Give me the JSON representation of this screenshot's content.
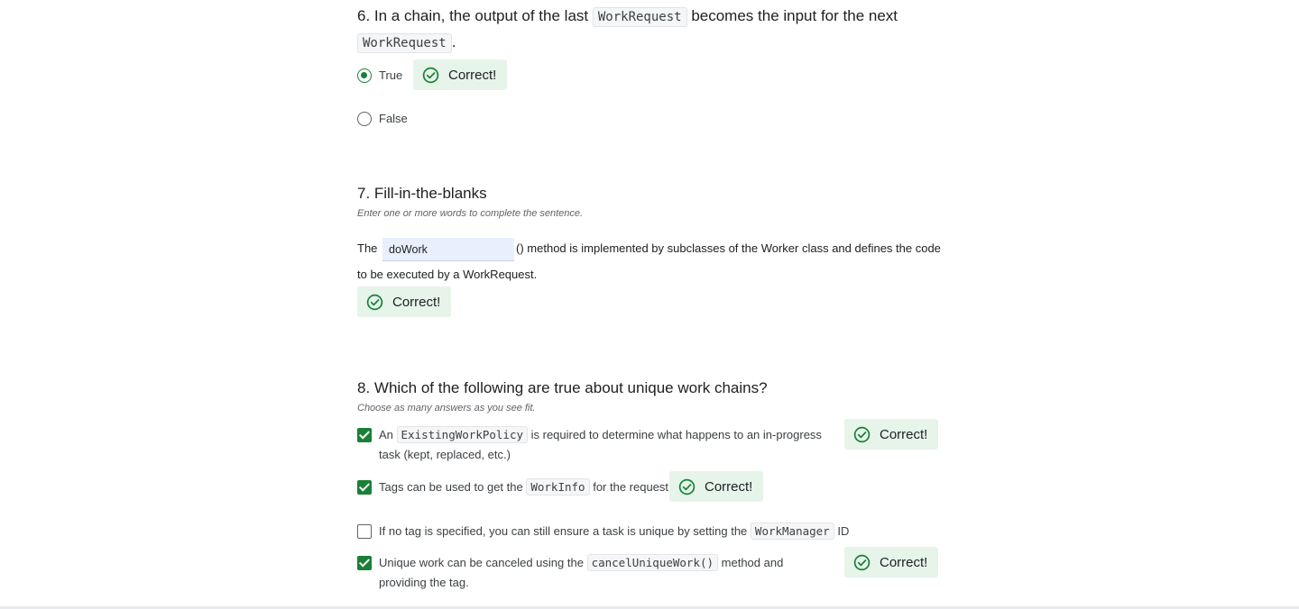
{
  "colors": {
    "accent": "#188038",
    "correct_bg": "#e6f4ea",
    "blank_bg": "#e8f0fe"
  },
  "q6": {
    "title_prefix": "6. In a chain, the output of the last",
    "code1": "WorkRequest",
    "title_mid": "becomes the input for the next",
    "code2": "WorkRequest",
    "title_end": ".",
    "options": [
      {
        "label": "True",
        "selected": true
      },
      {
        "label": "False",
        "selected": false
      }
    ],
    "feedback": "Correct!"
  },
  "q7": {
    "title": "7. Fill-in-the-blanks",
    "hint": "Enter one or more words to complete the sentence.",
    "sentence_before": "The",
    "blank_value": "doWork",
    "sentence_after": "() method is implemented by subclasses of the Worker class and defines the code to be executed by a WorkRequest.",
    "feedback": "Correct!"
  },
  "q8": {
    "title": "8. Which of the following are true about unique work chains?",
    "hint": "Choose as many answers as you see fit.",
    "options": [
      {
        "before": "An",
        "code": "ExistingWorkPolicy",
        "after": "is required to determine what happens to an in-progress task (kept, replaced, etc.)",
        "checked": true,
        "feedback": "Correct!"
      },
      {
        "before": "Tags can be used to get the",
        "code": "WorkInfo",
        "after": "for the request.",
        "checked": true,
        "feedback": "Correct!"
      },
      {
        "before": "If no tag is specified, you can still ensure a task is unique by setting the",
        "code": "WorkManager",
        "after": "ID",
        "checked": false,
        "feedback": ""
      },
      {
        "before": "Unique work can be canceled using the",
        "code": "cancelUniqueWork()",
        "after": "method and providing the tag.",
        "checked": true,
        "feedback": "Correct!"
      }
    ]
  },
  "icons": {
    "correct": "check-circle-icon"
  }
}
